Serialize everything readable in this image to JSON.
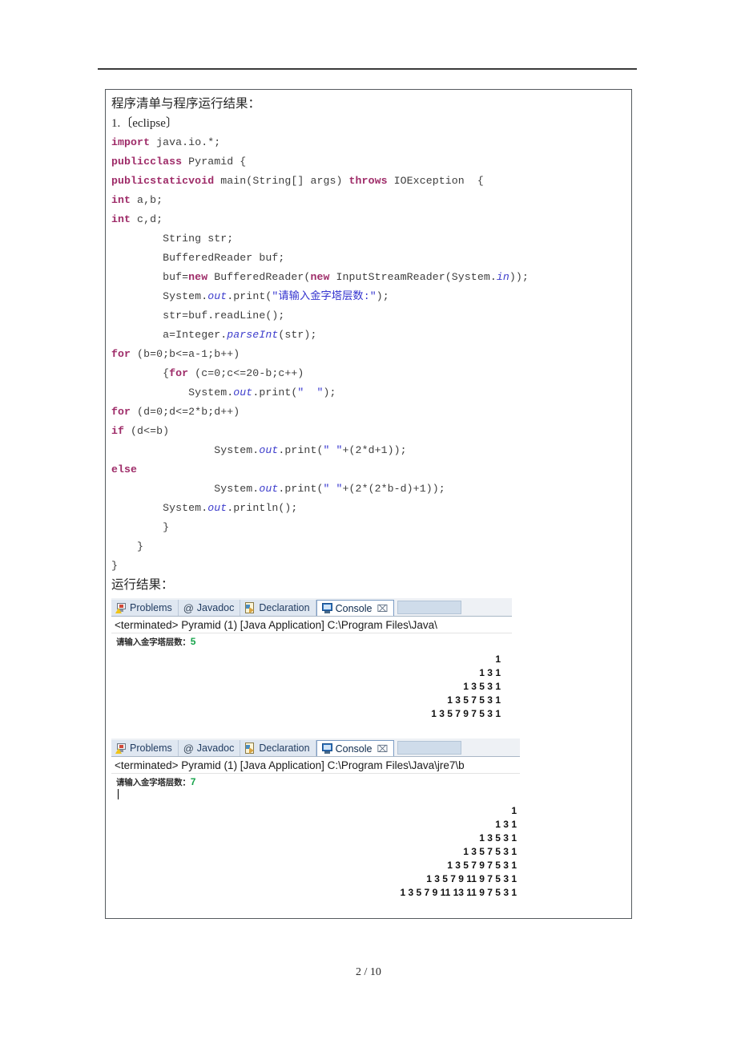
{
  "page": {
    "footer": "2 / 10",
    "header_rule": true
  },
  "document": {
    "title_line": "程序清单与程序运行结果：",
    "item_line": "1.〔eclipse〕",
    "result_label": "运行结果："
  },
  "code": {
    "lines": [
      [
        {
          "t": "import",
          "c": "kw"
        },
        {
          "t": " java.io.*;",
          "c": ""
        }
      ],
      [
        {
          "t": "publicclass",
          "c": "kw"
        },
        {
          "t": " Pyramid {",
          "c": ""
        }
      ],
      [
        {
          "t": "publicstaticvoid",
          "c": "kw"
        },
        {
          "t": " main(String[] args) ",
          "c": ""
        },
        {
          "t": "throws",
          "c": "kw"
        },
        {
          "t": " IOException  {",
          "c": ""
        }
      ],
      [
        {
          "t": "int",
          "c": "kw"
        },
        {
          "t": " a,b;",
          "c": ""
        }
      ],
      [
        {
          "t": "int",
          "c": "kw"
        },
        {
          "t": " c,d;",
          "c": ""
        }
      ],
      [
        {
          "t": "        String str;",
          "c": ""
        }
      ],
      [
        {
          "t": "        BufferedReader buf;",
          "c": ""
        }
      ],
      [
        {
          "t": "        buf=",
          "c": ""
        },
        {
          "t": "new",
          "c": "kw"
        },
        {
          "t": " BufferedReader(",
          "c": ""
        },
        {
          "t": "new",
          "c": "kw"
        },
        {
          "t": " InputStreamReader(System.",
          "c": ""
        },
        {
          "t": "in",
          "c": "fld"
        },
        {
          "t": "));",
          "c": ""
        }
      ],
      [
        {
          "t": "        System.",
          "c": ""
        },
        {
          "t": "out",
          "c": "fld"
        },
        {
          "t": ".print(",
          "c": ""
        },
        {
          "t": "\"请输入金字塔层数:\"",
          "c": "str"
        },
        {
          "t": ");",
          "c": ""
        }
      ],
      [
        {
          "t": "        str=buf.readLine();",
          "c": ""
        }
      ],
      [
        {
          "t": "        a=Integer.",
          "c": ""
        },
        {
          "t": "parseInt",
          "c": "fld"
        },
        {
          "t": "(str);",
          "c": ""
        }
      ],
      [
        {
          "t": "for",
          "c": "kw"
        },
        {
          "t": " (b=0;b<=a-1;b++)",
          "c": ""
        }
      ],
      [
        {
          "t": "        {",
          "c": ""
        },
        {
          "t": "for",
          "c": "kw"
        },
        {
          "t": " (c=0;c<=20-b;c++)",
          "c": ""
        }
      ],
      [
        {
          "t": "            System.",
          "c": ""
        },
        {
          "t": "out",
          "c": "fld"
        },
        {
          "t": ".print(",
          "c": ""
        },
        {
          "t": "\"  \"",
          "c": "str"
        },
        {
          "t": ");",
          "c": ""
        }
      ],
      [
        {
          "t": "for",
          "c": "kw"
        },
        {
          "t": " (d=0;d<=2*b;d++)",
          "c": ""
        }
      ],
      [
        {
          "t": "if",
          "c": "kw"
        },
        {
          "t": " (d<=b)",
          "c": ""
        }
      ],
      [
        {
          "t": "                System.",
          "c": ""
        },
        {
          "t": "out",
          "c": "fld"
        },
        {
          "t": ".print(",
          "c": ""
        },
        {
          "t": "\" \"",
          "c": "str"
        },
        {
          "t": "+(2*d+1));",
          "c": ""
        }
      ],
      [
        {
          "t": "else",
          "c": "kw"
        }
      ],
      [
        {
          "t": "                System.",
          "c": ""
        },
        {
          "t": "out",
          "c": "fld"
        },
        {
          "t": ".print(",
          "c": ""
        },
        {
          "t": "\" \"",
          "c": "str"
        },
        {
          "t": "+(2*(2*b-d)+1));",
          "c": ""
        }
      ],
      [
        {
          "t": "        System.",
          "c": ""
        },
        {
          "t": "out",
          "c": "fld"
        },
        {
          "t": ".println();",
          "c": ""
        }
      ],
      [
        {
          "t": "        }",
          "c": ""
        }
      ],
      [
        {
          "t": "    }",
          "c": ""
        }
      ],
      [
        {
          "t": "}",
          "c": ""
        }
      ]
    ]
  },
  "consoles": [
    {
      "tabs": [
        {
          "label": "Problems",
          "icon": "problems-icon",
          "active": false
        },
        {
          "label": "Javadoc",
          "icon": "at-icon",
          "active": false
        },
        {
          "label": "Declaration",
          "icon": "declaration-icon",
          "active": false
        },
        {
          "label": "Console",
          "icon": "console-icon",
          "active": true,
          "close": "⌧"
        }
      ],
      "status": "<terminated> Pyramid (1) [Java Application] C:\\Program Files\\Java\\",
      "prompt": "请输入金字塔层数：",
      "input_value": "5",
      "show_caret": false,
      "pyramid_lines": [
        "1",
        "1 3 1",
        "1 3 5 3 1",
        "1 3 5 7 5 3 1",
        "1 3 5 7 9 7 5 3 1"
      ]
    },
    {
      "tabs": [
        {
          "label": "Problems",
          "icon": "problems-icon",
          "active": false
        },
        {
          "label": "Javadoc",
          "icon": "at-icon",
          "active": false
        },
        {
          "label": "Declaration",
          "icon": "declaration-icon",
          "active": false
        },
        {
          "label": "Console",
          "icon": "console-icon",
          "active": true,
          "close": "⌧"
        }
      ],
      "status": "<terminated> Pyramid (1) [Java Application] C:\\Program Files\\Java\\jre7\\b",
      "prompt": "请输入金字塔层数：",
      "input_value": "7",
      "show_caret": true,
      "pyramid_lines": [
        "1",
        "1 3 1",
        "1 3 5 3 1",
        "1 3 5 7 5 3 1",
        "1 3 5 7 9 7 5 3 1",
        "1 3 5 7 9 11 9 7 5 3 1",
        "1 3 5 7 9 11 13 11 9 7 5 3 1"
      ]
    }
  ],
  "colors": {
    "keyword": "#9e2b68",
    "string": "#3434cf",
    "field": "#3d3dcc",
    "console_value": "#16a34a",
    "tab_active_bg": "#ffffff"
  }
}
